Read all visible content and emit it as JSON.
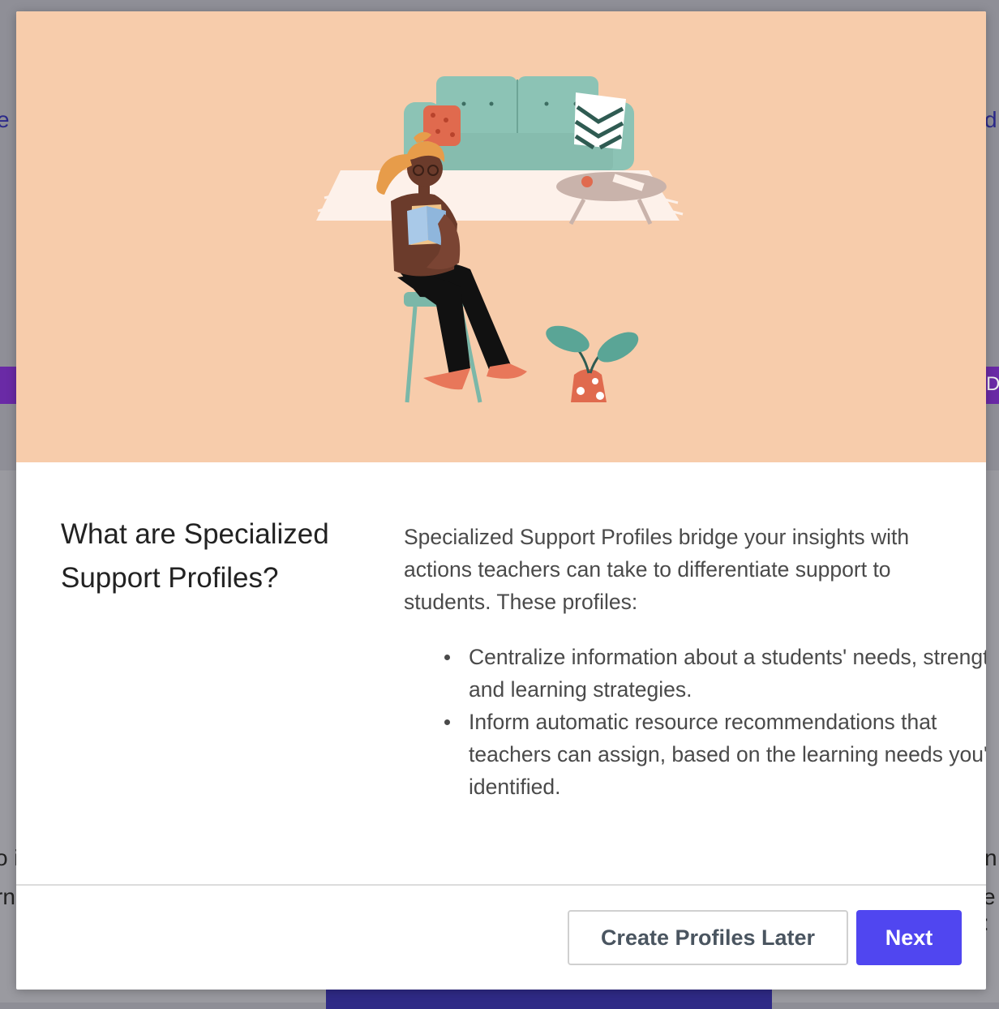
{
  "background": {
    "fragments": [
      "e e",
      "d",
      "D",
      "o i",
      "rn",
      "n",
      "e :"
    ]
  },
  "modal": {
    "title": "What are Specialized Support Profiles?",
    "description": "Specialized Support Profiles bridge your insights with actions teachers can take to differentiate support to students. These profiles:",
    "bullets": [
      "Centralize information about a students' needs, strengths, and learning strategies.",
      "Inform automatic resource recommendations that teachers can assign, based on the learning needs you've identified."
    ],
    "buttons": {
      "later_label": "Create Profiles Later",
      "next_label": "Next"
    },
    "colors": {
      "hero_background": "#f7ccab",
      "primary": "#5046f0",
      "sofa": "#8cc3b5"
    },
    "illustration": "woman-reading-on-stool-with-sofa-and-plant"
  }
}
